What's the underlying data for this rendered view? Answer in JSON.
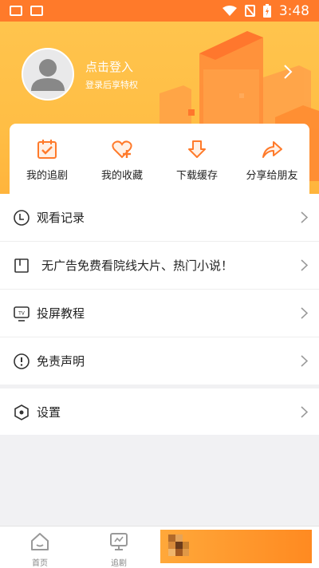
{
  "status_bar": {
    "time": "3:48"
  },
  "profile": {
    "login_title": "点击登入",
    "login_subtitle": "登录后享特权"
  },
  "quick_actions": [
    {
      "label": "我的追剧",
      "icon": "calendar-check-icon"
    },
    {
      "label": "我的收藏",
      "icon": "heart-plus-icon"
    },
    {
      "label": "下载缓存",
      "icon": "download-box-icon"
    },
    {
      "label": "分享给朋友",
      "icon": "share-arrow-icon"
    }
  ],
  "menu": [
    {
      "label": "观看记录",
      "icon": "clock-icon"
    },
    {
      "label": "无广告免费看院线大片、热门小说！",
      "icon": "book-icon"
    },
    {
      "label": "投屏教程",
      "icon": "tv-icon"
    },
    {
      "label": "免责声明",
      "icon": "alert-circle-icon"
    }
  ],
  "settings": {
    "label": "设置",
    "icon": "hexagon-gear-icon"
  },
  "bottom_nav": [
    {
      "label": "首页",
      "icon": "home-icon"
    },
    {
      "label": "追剧",
      "icon": "monitor-icon"
    }
  ],
  "colors": {
    "accent": "#ff7a2a",
    "header": "#ffc44d"
  }
}
